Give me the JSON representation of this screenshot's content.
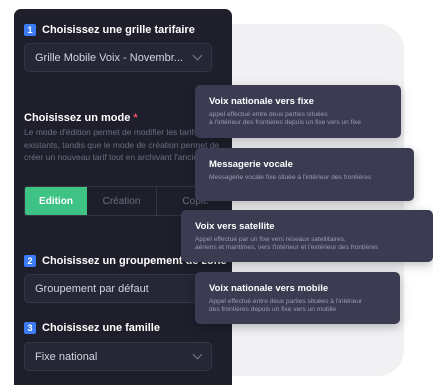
{
  "form": {
    "tariff_grid": {
      "step": "1",
      "label": "Choisissez une grille tarifaire",
      "value": "Grille Mobile Voix - Novembr..."
    },
    "mode": {
      "title": "Choisissez un mode",
      "required_mark": "*",
      "description": "Le mode d'édition permet de modifier les tarifs existants, tandis que le mode de création permet de créer un nouveau tarif tout en archivant l'ancien.",
      "options": [
        "Edition",
        "Création",
        "Copie"
      ],
      "selected": "Edition"
    },
    "zone_group": {
      "step": "2",
      "label": "Choisissez un groupement de zone",
      "value": "Groupement par défaut"
    },
    "family": {
      "step": "3",
      "label": "Choisissez une famille",
      "value": "Fixe national"
    }
  },
  "family_options": [
    {
      "title": "Voix nationale vers fixe",
      "desc": [
        "appel effectué entre deux parties situées",
        "à l'intérieur des frontières depuis un fixe vers un fixe"
      ]
    },
    {
      "title": "Messagerie vocale",
      "desc": [
        "Messagerie vocale fixe située à l'intérieur des frontières"
      ]
    },
    {
      "title": "Voix vers satellite",
      "desc": [
        "Appel effectué par un fixe vers réseaux satellitaires,",
        "aériens et maritimes, vers l'intérieur et l'extérieur des frontières"
      ]
    },
    {
      "title": "Voix nationale vers mobile",
      "desc": [
        "Appel effectué entre deux parties situées à l'intérieur",
        "des frontières depuis un fixe vers un mobile"
      ]
    }
  ],
  "colors": {
    "panel": "#1f1f2c",
    "step_badge": "#3b7cf6",
    "active_segment": "#3ec384",
    "required": "#ef4b6b",
    "tooltip": "#3b3b52"
  }
}
